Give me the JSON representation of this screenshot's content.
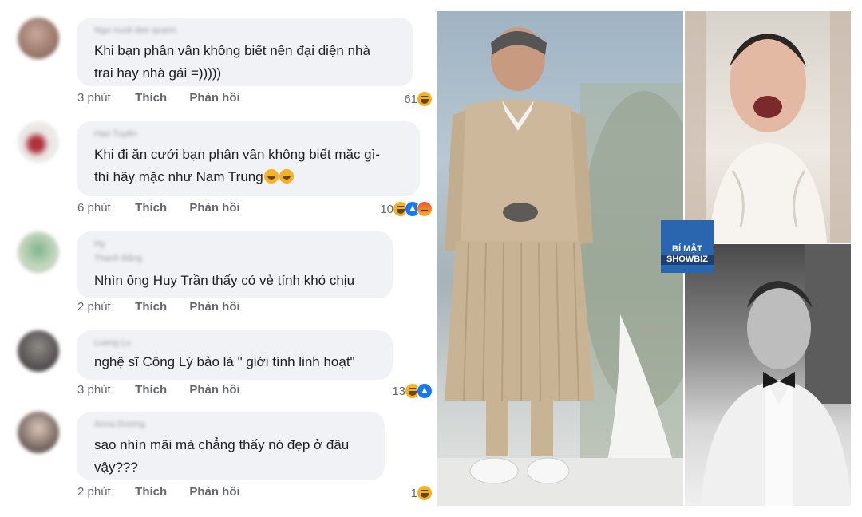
{
  "comments": [
    {
      "text_lines": [
        "Khi bạn phân vân không biết nên đại diện nhà",
        "trai hay nhà gái =)))))"
      ],
      "time": "3 phút",
      "like": "Thích",
      "reply": "Phản hồi",
      "reaction_count": "61",
      "reactions": [
        "haha"
      ]
    },
    {
      "text_lines": [
        "Khi đi ăn cưới bạn phân vân không biết mặc gì-",
        "thì hãy mặc như Nam Trung"
      ],
      "time": "6 phút",
      "like": "Thích",
      "reply": "Phản hồi",
      "reaction_count": "10",
      "reactions": [
        "haha",
        "like",
        "angry"
      ]
    },
    {
      "text_lines": [
        "Nhìn ông Huy Trần thấy có vẻ tính khó chịu"
      ],
      "time": "2 phút",
      "like": "Thích",
      "reply": "Phản hồi",
      "reaction_count": "",
      "reactions": []
    },
    {
      "text_lines": [
        "nghệ sĩ Công Lý bảo là \" giới tính linh hoạt\""
      ],
      "time": "3 phút",
      "like": "Thích",
      "reply": "Phản hồi",
      "reaction_count": "13",
      "reactions": [
        "haha",
        "like"
      ]
    },
    {
      "text_lines": [
        "sao nhìn mãi mà chẳng thấy nó đẹp ở đâu",
        "vậy???"
      ],
      "time": "2 phút",
      "like": "Thích",
      "reply": "Phản hồi",
      "reaction_count": "1",
      "reactions": [
        "haha"
      ]
    }
  ],
  "watermark": {
    "line1": "BÍ MẬT",
    "line2": "SHOWBIZ"
  }
}
